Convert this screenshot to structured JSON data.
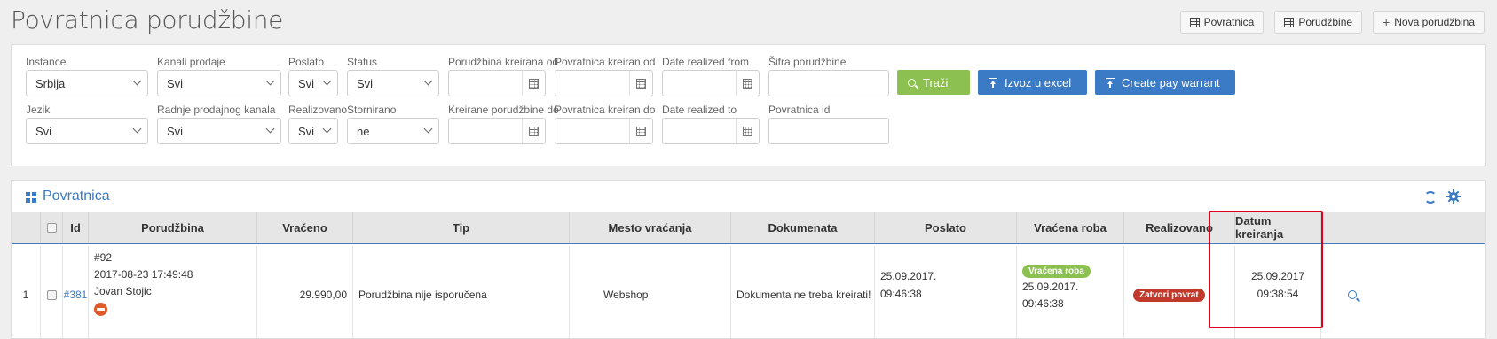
{
  "page": {
    "title": "Povratnica porudžbine"
  },
  "top_buttons": {
    "povratnica": "Povratnica",
    "porudzbine": "Porudžbine",
    "nova": "Nova porudžbina"
  },
  "filters": {
    "instance": {
      "label": "Instance",
      "value": "Srbija"
    },
    "kanali_prodaje": {
      "label": "Kanali prodaje",
      "value": "Svi"
    },
    "poslato": {
      "label": "Poslato",
      "value": "Svi"
    },
    "status": {
      "label": "Status",
      "value": "Svi"
    },
    "porudzbina_kreirana_od": {
      "label": "Porudžbina kreirana od",
      "value": ""
    },
    "povratnica_kreiran_od": {
      "label": "Povratnica kreiran od",
      "value": ""
    },
    "date_realized_from": {
      "label": "Date realized from",
      "value": ""
    },
    "sifra_porudzbine": {
      "label": "Šifra porudžbine",
      "value": ""
    },
    "jezik": {
      "label": "Jezik",
      "value": "Svi"
    },
    "radnje_prodajnog_kanala": {
      "label": "Radnje prodajnog kanala",
      "value": "Svi"
    },
    "realizovano": {
      "label": "Realizovano",
      "value": "Svi"
    },
    "stornirano": {
      "label": "Stornirano",
      "value": "ne"
    },
    "kreirane_porudzbine_do": {
      "label": "Kreirane porudžbine do",
      "value": ""
    },
    "povratnica_kreiran_do": {
      "label": "Povratnica kreiran do",
      "value": ""
    },
    "date_realized_to": {
      "label": "Date realized to",
      "value": ""
    },
    "povratnica_id": {
      "label": "Povratnica id",
      "value": ""
    }
  },
  "actions": {
    "trazi": "Traži",
    "izvoz": "Izvoz u excel",
    "pay_warrant": "Create pay warrant"
  },
  "table": {
    "title": "Povratnica",
    "headers": {
      "id": "Id",
      "porudzbina": "Porudžbina",
      "vraceno": "Vraćeno",
      "tip": "Tip",
      "mesto": "Mesto vraćanja",
      "dokumenata": "Dokumenata",
      "poslato": "Poslato",
      "vracena_roba": "Vraćena roba",
      "realizovano": "Realizovano",
      "datum": "Datum kreiranja"
    },
    "rows": [
      {
        "num": "1",
        "id": "#381",
        "order_no": "#92",
        "order_date": "2017-08-23 17:49:48",
        "customer": "Jovan Stojic",
        "vraceno": "29.990,00",
        "tip": "Porudžbina nije isporučena",
        "mesto": "Webshop",
        "dokumenata": "Dokumenta ne treba kreirati!",
        "poslato_date": "25.09.2017.",
        "poslato_time": "09:46:38",
        "vracena_badge": "Vraćena roba",
        "vracena_date": "25.09.2017.",
        "vracena_time": "09:46:38",
        "realizovano_badge": "Zatvori povrat",
        "datum_date": "25.09.2017",
        "datum_time": "09:38:54"
      }
    ]
  },
  "colors": {
    "accent": "#3b7ac4",
    "green": "#8cc152",
    "highlight": "#e0001b",
    "danger": "#c0392b"
  }
}
